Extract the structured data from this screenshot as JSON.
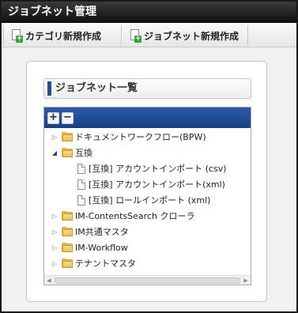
{
  "window": {
    "title": "ジョブネット管理"
  },
  "toolbar": {
    "new_category_label": "カテゴリ新規作成",
    "new_jobnet_label": "ジョブネット新規作成"
  },
  "panel": {
    "heading": "ジョブネット一覧",
    "tree_controls": {
      "expand_label": "+",
      "collapse_label": "−"
    },
    "tree": [
      {
        "label": "ドキュメントワークフロー(BPW)",
        "type": "folder",
        "expanded": false
      },
      {
        "label": "互換",
        "type": "folder",
        "expanded": true,
        "children": [
          {
            "label": "[互換] アカウントインポート (csv)",
            "type": "file"
          },
          {
            "label": "[互換] アカウントインポート(xml)",
            "type": "file"
          },
          {
            "label": "[互換] ロールインポート (xml)",
            "type": "file"
          }
        ]
      },
      {
        "label": "IM-ContentsSearch クローラ",
        "type": "folder",
        "expanded": false
      },
      {
        "label": "IM共通マスタ",
        "type": "folder",
        "expanded": false
      },
      {
        "label": "IM-Workflow",
        "type": "folder",
        "expanded": false
      },
      {
        "label": "テナントマスタ",
        "type": "folder",
        "expanded": false
      }
    ]
  },
  "icons": {
    "collapsed": "triangle-right",
    "expanded": "triangle-down",
    "folder": "folder-icon",
    "file": "document-icon",
    "add": "page-plus-icon"
  },
  "colors": {
    "titlebar": "#1a1a1a",
    "tree_header": "#1f478f",
    "accent": "#2b4d8f"
  }
}
